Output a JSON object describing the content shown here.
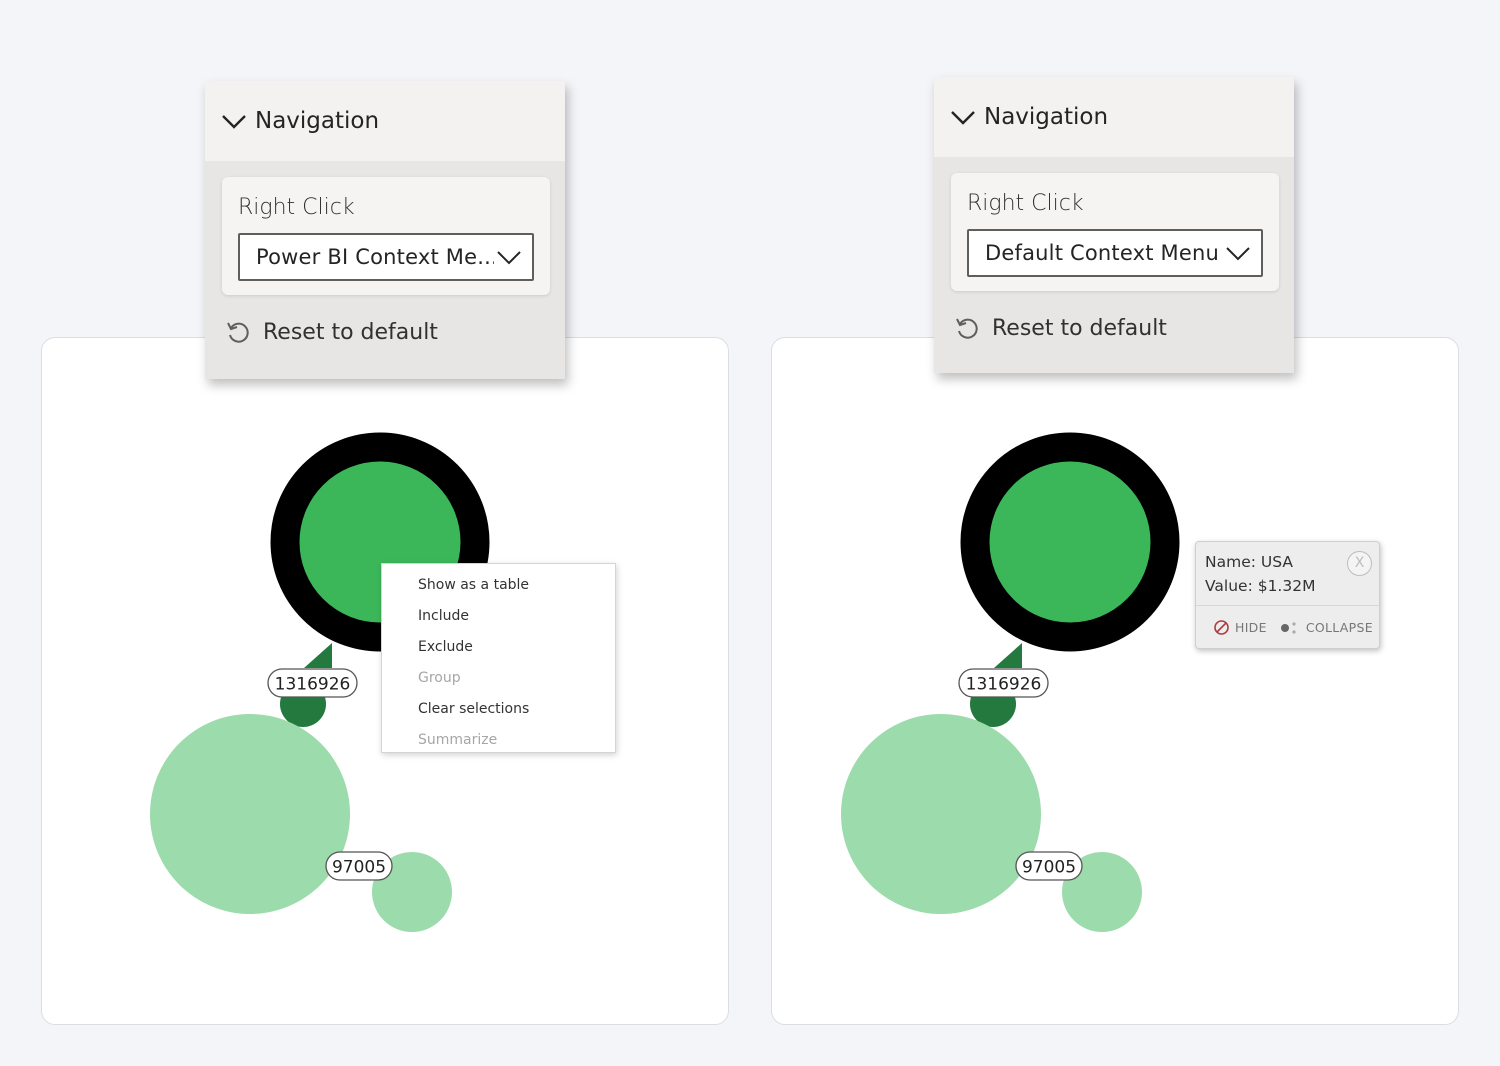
{
  "colors": {
    "node_dark": "#000000",
    "node_green": "#3bb75a",
    "node_dark_green": "#23793e",
    "node_light_green": "#9cdbab",
    "background": "#f4f5f9"
  },
  "left_panel": {
    "section_title": "Navigation",
    "field_label": "Right Click",
    "select_value": "Power BI Context Me...",
    "reset_label": "Reset to default"
  },
  "right_panel": {
    "section_title": "Navigation",
    "field_label": "Right Click",
    "select_value": "Default Context Menu",
    "reset_label": "Reset to default"
  },
  "graph": {
    "nodes": [
      {
        "label": "1316926"
      },
      {
        "label": "97005"
      }
    ]
  },
  "context_menu": {
    "items": [
      {
        "label": "Show as a table",
        "enabled": true
      },
      {
        "label": "Include",
        "enabled": true
      },
      {
        "label": "Exclude",
        "enabled": true
      },
      {
        "label": "Group",
        "enabled": false
      },
      {
        "label": "Clear selections",
        "enabled": true
      },
      {
        "label": "Summarize",
        "enabled": false
      }
    ]
  },
  "tooltip": {
    "name_line": "Name: USA",
    "value_line": "Value: $1.32M",
    "close_label": "X",
    "hide_label": "HIDE",
    "collapse_label": "COLLAPSE"
  }
}
